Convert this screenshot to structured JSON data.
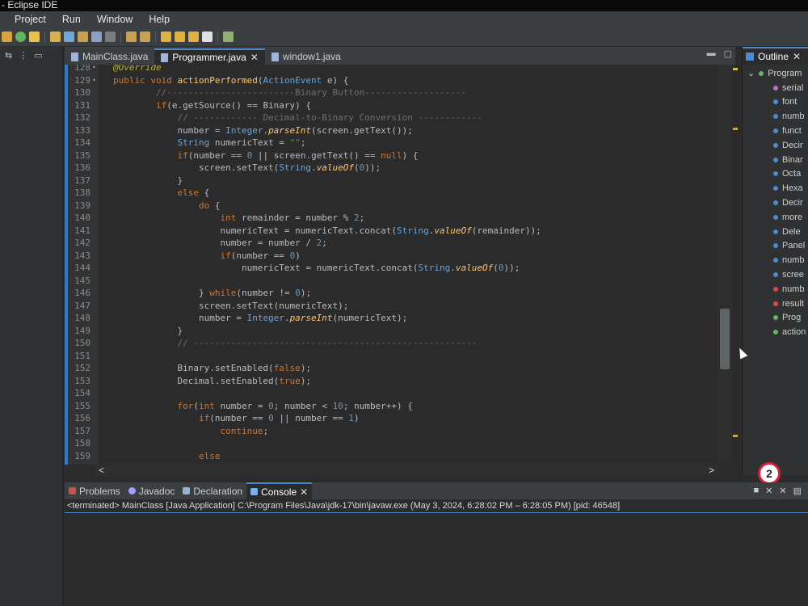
{
  "window": {
    "title": "- Eclipse IDE"
  },
  "menu": [
    "Project",
    "Run",
    "Window",
    "Help"
  ],
  "editor_tabs": [
    {
      "label": "MainClass.java",
      "active": false,
      "closable": false
    },
    {
      "label": "Programmer.java",
      "active": true,
      "closable": true
    },
    {
      "label": "window1.java",
      "active": false,
      "closable": false
    }
  ],
  "tab_close_glyph": "✕",
  "code_lines": [
    {
      "n": "128",
      "mark": "•",
      "segments": [
        [
          "an it",
          "@Override"
        ]
      ]
    },
    {
      "n": "129",
      "mark": "•",
      "segments": [
        [
          "kw",
          "public "
        ],
        [
          "kw",
          "void "
        ],
        [
          "fn",
          "actionPerformed"
        ],
        [
          "",
          "("
        ],
        [
          "ty",
          "ActionEvent"
        ],
        [
          "",
          " e) {"
        ]
      ]
    },
    {
      "n": "130",
      "mark": "",
      "segments": [
        [
          "",
          "        "
        ],
        [
          "cm",
          "//------------------------Binary Button-------------------"
        ]
      ]
    },
    {
      "n": "131",
      "mark": "",
      "segments": [
        [
          "",
          "        "
        ],
        [
          "kw",
          "if"
        ],
        [
          "",
          "(e.getSource() == Binary) {"
        ]
      ]
    },
    {
      "n": "132",
      "mark": "",
      "segments": [
        [
          "",
          "            "
        ],
        [
          "cm",
          "// ------------ Decimal-to-Binary Conversion ------------"
        ]
      ]
    },
    {
      "n": "133",
      "mark": "",
      "segments": [
        [
          "",
          "            number = "
        ],
        [
          "ty",
          "Integer"
        ],
        [
          "",
          "."
        ],
        [
          "fn it",
          "parseInt"
        ],
        [
          "",
          "(screen.getText());"
        ]
      ]
    },
    {
      "n": "134",
      "mark": "",
      "segments": [
        [
          "",
          "            "
        ],
        [
          "ty",
          "String"
        ],
        [
          "",
          " numericText = "
        ],
        [
          "st",
          "\"\""
        ],
        [
          "",
          ";"
        ]
      ]
    },
    {
      "n": "135",
      "mark": "",
      "segments": [
        [
          "",
          "            "
        ],
        [
          "kw",
          "if"
        ],
        [
          "",
          "(number == "
        ],
        [
          "num",
          "0"
        ],
        [
          "",
          " || screen.getText() == "
        ],
        [
          "kw",
          "null"
        ],
        [
          "",
          ") {"
        ]
      ]
    },
    {
      "n": "136",
      "mark": "",
      "segments": [
        [
          "",
          "                screen.setText("
        ],
        [
          "ty",
          "String"
        ],
        [
          "",
          "."
        ],
        [
          "fn it",
          "valueOf"
        ],
        [
          "",
          "("
        ],
        [
          "num",
          "0"
        ],
        [
          "",
          "));"
        ]
      ]
    },
    {
      "n": "137",
      "mark": "",
      "segments": [
        [
          "",
          "            }"
        ]
      ]
    },
    {
      "n": "138",
      "mark": "",
      "segments": [
        [
          "",
          "            "
        ],
        [
          "kw",
          "else"
        ],
        [
          "",
          " {"
        ]
      ]
    },
    {
      "n": "139",
      "mark": "",
      "segments": [
        [
          "",
          "                "
        ],
        [
          "kw",
          "do"
        ],
        [
          "",
          " {"
        ]
      ]
    },
    {
      "n": "140",
      "mark": "",
      "segments": [
        [
          "",
          "                    "
        ],
        [
          "kw",
          "int"
        ],
        [
          "",
          " remainder = number % "
        ],
        [
          "num",
          "2"
        ],
        [
          "",
          ";"
        ]
      ]
    },
    {
      "n": "141",
      "mark": "",
      "segments": [
        [
          "",
          "                    numericText = numericText.concat("
        ],
        [
          "ty",
          "String"
        ],
        [
          "",
          "."
        ],
        [
          "fn it",
          "valueOf"
        ],
        [
          "",
          "(remainder));"
        ]
      ]
    },
    {
      "n": "142",
      "mark": "",
      "segments": [
        [
          "",
          "                    number = number / "
        ],
        [
          "num",
          "2"
        ],
        [
          "",
          ";"
        ]
      ]
    },
    {
      "n": "143",
      "mark": "",
      "segments": [
        [
          "",
          "                    "
        ],
        [
          "kw",
          "if"
        ],
        [
          "",
          "(number == "
        ],
        [
          "num",
          "0"
        ],
        [
          "",
          ")"
        ]
      ]
    },
    {
      "n": "144",
      "mark": "",
      "segments": [
        [
          "",
          "                        numericText = numericText.concat("
        ],
        [
          "ty",
          "String"
        ],
        [
          "",
          "."
        ],
        [
          "fn it",
          "valueOf"
        ],
        [
          "",
          "("
        ],
        [
          "num",
          "0"
        ],
        [
          "",
          "));"
        ]
      ]
    },
    {
      "n": "145",
      "mark": "",
      "segments": [
        [
          "",
          ""
        ]
      ]
    },
    {
      "n": "146",
      "mark": "",
      "segments": [
        [
          "",
          "                } "
        ],
        [
          "kw",
          "while"
        ],
        [
          "",
          "(number != "
        ],
        [
          "num",
          "0"
        ],
        [
          "",
          ");"
        ]
      ]
    },
    {
      "n": "147",
      "mark": "",
      "segments": [
        [
          "",
          "                screen.setText(numericText);"
        ]
      ]
    },
    {
      "n": "148",
      "mark": "",
      "segments": [
        [
          "",
          "                number = "
        ],
        [
          "ty",
          "Integer"
        ],
        [
          "",
          "."
        ],
        [
          "fn it",
          "parseInt"
        ],
        [
          "",
          "(numericText);"
        ]
      ]
    },
    {
      "n": "149",
      "mark": "",
      "segments": [
        [
          "",
          "            }"
        ]
      ]
    },
    {
      "n": "150",
      "mark": "",
      "segments": [
        [
          "",
          "            "
        ],
        [
          "cm",
          "// -----------------------------------------------------"
        ]
      ]
    },
    {
      "n": "151",
      "mark": "",
      "segments": [
        [
          "",
          ""
        ]
      ]
    },
    {
      "n": "152",
      "mark": "",
      "segments": [
        [
          "",
          "            Binary.setEnabled("
        ],
        [
          "kw",
          "false"
        ],
        [
          "",
          ");"
        ]
      ]
    },
    {
      "n": "153",
      "mark": "",
      "segments": [
        [
          "",
          "            Decimal.setEnabled("
        ],
        [
          "kw",
          "true"
        ],
        [
          "",
          ");"
        ]
      ]
    },
    {
      "n": "154",
      "mark": "",
      "segments": [
        [
          "",
          ""
        ]
      ]
    },
    {
      "n": "155",
      "mark": "",
      "segments": [
        [
          "",
          "            "
        ],
        [
          "kw",
          "for"
        ],
        [
          "",
          "("
        ],
        [
          "kw",
          "int"
        ],
        [
          "",
          " number = "
        ],
        [
          "num",
          "0"
        ],
        [
          "",
          "; number < "
        ],
        [
          "num",
          "10"
        ],
        [
          "",
          "; number++) {"
        ]
      ]
    },
    {
      "n": "156",
      "mark": "",
      "segments": [
        [
          "",
          "                "
        ],
        [
          "kw",
          "if"
        ],
        [
          "",
          "(number == "
        ],
        [
          "num",
          "0"
        ],
        [
          "",
          " || number == "
        ],
        [
          "num",
          "1"
        ],
        [
          "",
          ")"
        ]
      ]
    },
    {
      "n": "157",
      "mark": "",
      "segments": [
        [
          "",
          "                    "
        ],
        [
          "kw",
          "continue"
        ],
        [
          "",
          ";"
        ]
      ]
    },
    {
      "n": "158",
      "mark": "",
      "segments": [
        [
          "",
          ""
        ]
      ]
    },
    {
      "n": "159",
      "mark": "",
      "segments": [
        [
          "",
          "                "
        ],
        [
          "kw",
          "else"
        ]
      ]
    }
  ],
  "hscroll": {
    "left": "<",
    "right": ">"
  },
  "outline": {
    "tab_label": "Outline",
    "items": [
      {
        "label": "Program",
        "color": "#5fb85f"
      },
      {
        "label": "serial",
        "color": "#c070c0"
      },
      {
        "label": "font",
        "color": "#4a8ad0"
      },
      {
        "label": "numb",
        "color": "#4a8ad0"
      },
      {
        "label": "funct",
        "color": "#4a8ad0"
      },
      {
        "label": "Decir",
        "color": "#4a8ad0"
      },
      {
        "label": "Binar",
        "color": "#4a8ad0"
      },
      {
        "label": "Octa",
        "color": "#4a8ad0"
      },
      {
        "label": "Hexa",
        "color": "#4a8ad0"
      },
      {
        "label": "Decir",
        "color": "#4a8ad0"
      },
      {
        "label": "more",
        "color": "#4a8ad0"
      },
      {
        "label": "Dele",
        "color": "#4a8ad0"
      },
      {
        "label": "Panel",
        "color": "#4a8ad0"
      },
      {
        "label": "numb",
        "color": "#4a8ad0"
      },
      {
        "label": "scree",
        "color": "#4a8ad0"
      },
      {
        "label": "numb",
        "color": "#e04848"
      },
      {
        "label": "result",
        "color": "#e04848"
      },
      {
        "label": "Prog",
        "color": "#5fb85f"
      },
      {
        "label": "action",
        "color": "#5fb85f"
      }
    ]
  },
  "badge": "2",
  "bottom_tabs": [
    {
      "label": "Problems",
      "active": false,
      "icon_color": "#d05050"
    },
    {
      "label": "Javadoc",
      "active": false,
      "icon_color": "#a0a0ff"
    },
    {
      "label": "Declaration",
      "active": false,
      "icon_color": "#9ab0d0"
    },
    {
      "label": "Console",
      "active": true,
      "icon_color": "#7ab0f0"
    }
  ],
  "console": {
    "status": "<terminated> MainClass [Java Application] C:\\Program Files\\Java\\jdk-17\\bin\\javaw.exe  (May 3, 2024, 6:28:02 PM – 6:28:05 PM) [pid: 46548]"
  },
  "colors": {
    "accent": "#4a88c7",
    "badge_ring": "#d8203c"
  }
}
